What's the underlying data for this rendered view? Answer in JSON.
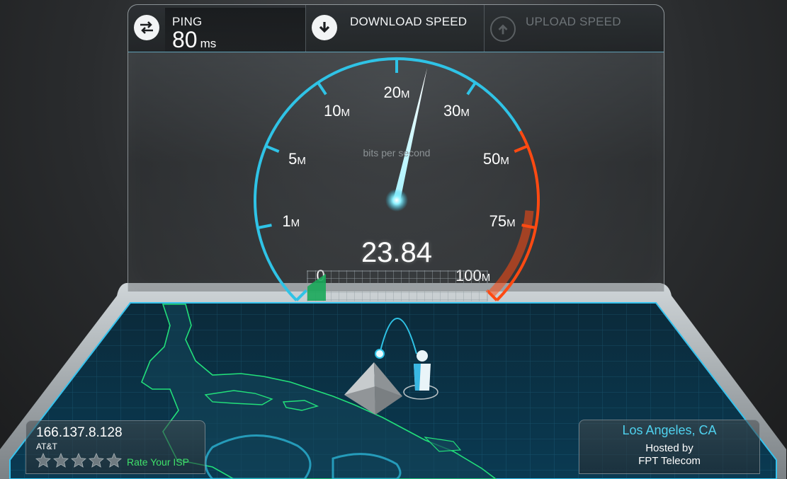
{
  "metrics": {
    "ping_label": "PING",
    "ping_value": "80",
    "ping_unit": "ms",
    "download_label": "DOWNLOAD SPEED",
    "upload_label": "UPLOAD SPEED"
  },
  "gauge": {
    "unit_caption": "bits per second",
    "current_value": "23.84",
    "current_speed_mbps": 23.84,
    "ticks": [
      {
        "num": "0",
        "unit": ""
      },
      {
        "num": "1",
        "unit": "M"
      },
      {
        "num": "5",
        "unit": "M"
      },
      {
        "num": "10",
        "unit": "M"
      },
      {
        "num": "20",
        "unit": "M"
      },
      {
        "num": "30",
        "unit": "M"
      },
      {
        "num": "50",
        "unit": "M"
      },
      {
        "num": "75",
        "unit": "M"
      },
      {
        "num": "100",
        "unit": "M"
      }
    ],
    "colors": {
      "normal": "#2fc3e6",
      "high": "#ff4a12",
      "needle": "#ffffff"
    }
  },
  "client": {
    "ip": "166.137.8.128",
    "isp": "AT&T",
    "rating_stars": 0,
    "rating_max": 5,
    "rate_label": "Rate Your ISP",
    "rate_color": "#3fe06a"
  },
  "server": {
    "city": "Los Angeles, CA",
    "hosted_label": "Hosted by",
    "host": "FPT Telecom",
    "city_color": "#4fd2ef"
  },
  "icons": {
    "ping": "swap-arrows-icon",
    "download": "download-arrow-icon",
    "upload": "upload-arrow-icon",
    "server": "pyramid-server-icon",
    "user": "person-icon"
  }
}
